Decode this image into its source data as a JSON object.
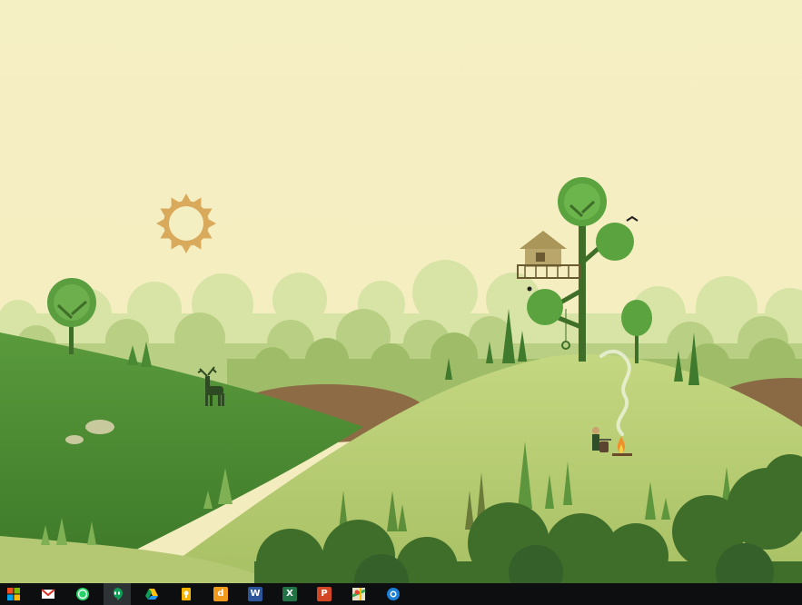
{
  "desktop": {
    "wallpaper_name": "green-hills-treehouse-wallpaper"
  },
  "taskbar": {
    "apps": [
      {
        "name": "start",
        "icon": "windows-start-icon",
        "label": "",
        "color": "#e03b2a",
        "active": false
      },
      {
        "name": "gmail",
        "icon": "gmail-icon",
        "label": "",
        "color": "#d93025",
        "active": false
      },
      {
        "name": "whatsapp",
        "icon": "whatsapp-icon",
        "label": "",
        "color": "#25d366",
        "active": false
      },
      {
        "name": "hangouts",
        "icon": "hangouts-icon",
        "label": "",
        "color": "#0f9d58",
        "active": true
      },
      {
        "name": "google-drive",
        "icon": "google-drive-icon",
        "label": "",
        "color": "#1da462",
        "active": false
      },
      {
        "name": "google-keep",
        "icon": "google-keep-icon",
        "label": "",
        "color": "#f7b500",
        "active": false
      },
      {
        "name": "dictionary",
        "icon": "dictionary-d-icon",
        "label": "d",
        "color": "#f29a1c",
        "active": false
      },
      {
        "name": "word",
        "icon": "word-icon",
        "label": "W",
        "color": "#2b579a",
        "active": false
      },
      {
        "name": "excel",
        "icon": "excel-icon",
        "label": "X",
        "color": "#217346",
        "active": false
      },
      {
        "name": "powerpoint",
        "icon": "powerpoint-icon",
        "label": "P",
        "color": "#d24726",
        "active": false
      },
      {
        "name": "google-maps",
        "icon": "google-maps-icon",
        "label": "",
        "color": "#34a853",
        "active": false
      },
      {
        "name": "browser",
        "icon": "browser-icon",
        "label": "",
        "color": "#1b7fd6",
        "active": false
      }
    ]
  }
}
